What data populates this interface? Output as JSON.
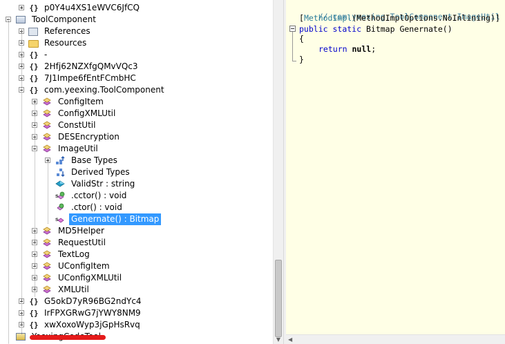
{
  "tree": {
    "rows": [
      {
        "label": "p0Y4u4XS1eWVC6JfCQ",
        "icon": "namespace",
        "expander": "plus",
        "level": 2
      },
      {
        "label": "ToolComponent",
        "icon": "assembly",
        "expander": "minus",
        "level": 0
      },
      {
        "label": "References",
        "icon": "references",
        "expander": "plus",
        "level": 2
      },
      {
        "label": "Resources",
        "icon": "folder",
        "expander": "plus",
        "level": 2
      },
      {
        "label": "-",
        "icon": "namespace",
        "expander": "plus",
        "level": 2
      },
      {
        "label": "2Hfj62NZXfgQMvVQc3",
        "icon": "namespace",
        "expander": "plus",
        "level": 2
      },
      {
        "label": "7J1Impe6fEntFCmbHC",
        "icon": "namespace",
        "expander": "plus",
        "level": 2
      },
      {
        "label": "com.yeexing.ToolComponent",
        "icon": "namespace",
        "expander": "minus",
        "level": 2
      },
      {
        "label": "ConfigItem",
        "icon": "class",
        "expander": "plus",
        "level": 3
      },
      {
        "label": "ConfigXMLUtil",
        "icon": "class",
        "expander": "plus",
        "level": 3
      },
      {
        "label": "ConstUtil",
        "icon": "class",
        "expander": "plus",
        "level": 3
      },
      {
        "label": "DESEncryption",
        "icon": "class",
        "expander": "plus",
        "level": 3
      },
      {
        "label": "ImageUtil",
        "icon": "class",
        "expander": "minus",
        "level": 3
      },
      {
        "label": "Base Types",
        "icon": "base-types",
        "expander": "plus",
        "level": 4
      },
      {
        "label": "Derived Types",
        "icon": "derived-types",
        "expander": "none",
        "level": 4
      },
      {
        "label": "ValidStr : string",
        "icon": "field",
        "expander": "none",
        "level": 4
      },
      {
        "label": ".cctor() : void",
        "icon": "static-method",
        "expander": "none",
        "level": 4
      },
      {
        "label": ".ctor() : void",
        "icon": "method",
        "expander": "none",
        "level": 4
      },
      {
        "label": "Genernate() : Bitmap",
        "icon": "static-method-selected",
        "expander": "none",
        "level": 4,
        "selected": true
      },
      {
        "label": "MD5Helper",
        "icon": "class",
        "expander": "plus",
        "level": 3
      },
      {
        "label": "RequestUtil",
        "icon": "class",
        "expander": "plus",
        "level": 3
      },
      {
        "label": "TextLog",
        "icon": "class",
        "expander": "plus",
        "level": 3
      },
      {
        "label": "UConfigItem",
        "icon": "class",
        "expander": "plus",
        "level": 3
      },
      {
        "label": "UConfigXMLUtil",
        "icon": "class",
        "expander": "plus",
        "level": 3
      },
      {
        "label": "XMLUtil",
        "icon": "class",
        "expander": "plus",
        "level": 3
      },
      {
        "label": "G5okD7yR96BG2ndYc4",
        "icon": "namespace",
        "expander": "plus",
        "level": 2
      },
      {
        "label": "IrFPXGRwG7jYWY8NM9",
        "icon": "namespace",
        "expander": "plus",
        "level": 2
      },
      {
        "label": "xwXoxoWyp3jGpHsRvq",
        "icon": "namespace",
        "expander": "plus",
        "level": 2
      },
      {
        "label": "YeexingCodeTool",
        "icon": "assembly-locked",
        "expander": "none",
        "level": 0,
        "redacted": true
      }
    ]
  },
  "code": {
    "comment": "// com.yeexing.ToolComponent.ImageUtil",
    "attr_open": "[",
    "attr_name": "MethodImpl",
    "attr_args": "(MethodImplOptions.NoInlining)]",
    "sig_kw1": "public",
    "sig_kw2": "static",
    "sig_type": "Bitmap",
    "sig_name": "Genernate",
    "sig_parens": "()",
    "brace_open": "{",
    "ret_kw": "return",
    "ret_val": "null",
    "ret_semi": ";",
    "brace_close": "}"
  },
  "icons": {
    "namespace": "namespace-braces-icon",
    "class": "class-icon",
    "method": "method-icon",
    "field": "field-icon",
    "assembly": "assembly-icon",
    "folder": "folder-icon"
  },
  "colors": {
    "selection": "#3399ff",
    "code_background": "#ffffe6",
    "keyword": "#0000cc",
    "comment": "#3f7f9f"
  }
}
